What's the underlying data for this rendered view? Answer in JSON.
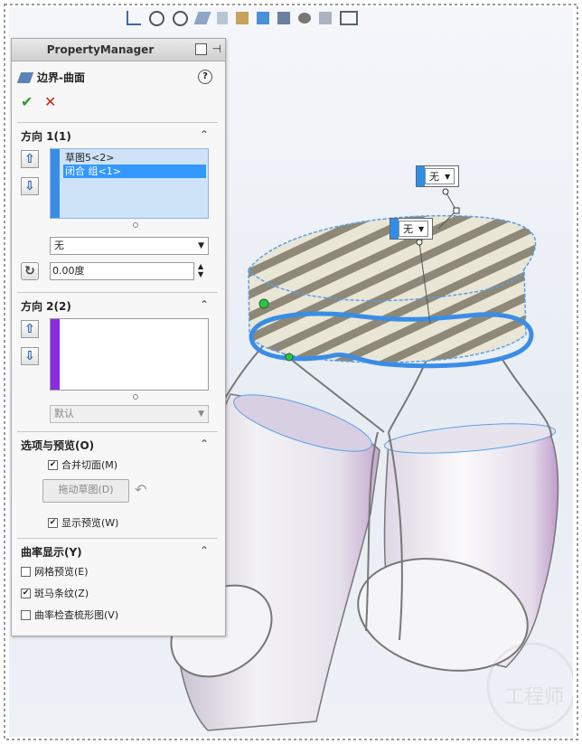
{
  "toolbar": {
    "icons": [
      "view-orientation-icon",
      "zoom-fit-icon",
      "zoom-area-icon",
      "previous-view-icon",
      "section-view-icon",
      "view-settings-icon",
      "display-style-icon",
      "hide-show-icon",
      "edit-appearance-icon",
      "apply-scene-icon",
      "display-manager-icon"
    ]
  },
  "property_manager": {
    "title": "PropertyManager",
    "feature_title": "边界-曲面",
    "direction1": {
      "header": "方向 1(1)",
      "items": [
        "草图5<2>",
        "闭合 组<1>"
      ],
      "selected_index": 1,
      "tangent_option": "无",
      "angle_value": "0.00度",
      "stripe_color": "#3a8de6"
    },
    "direction2": {
      "header": "方向 2(2)",
      "items": [],
      "tangent_option": "默认",
      "stripe_color": "#8a2be2"
    },
    "options": {
      "header": "选项与预览(O)",
      "merge_tangent_faces": {
        "label": "合并切面(M)",
        "checked": true
      },
      "drag_sketch_button": "拖动草图(D)",
      "show_preview": {
        "label": "显示预览(W)",
        "checked": true
      }
    },
    "curvature": {
      "header": "曲率显示(Y)",
      "mesh_preview": {
        "label": "网格预览(E)",
        "checked": false
      },
      "zebra_stripes": {
        "label": "斑马条纹(Z)",
        "checked": true
      },
      "curvature_comb": {
        "label": "曲率检查梳形图(V)",
        "checked": false
      }
    }
  },
  "callouts": {
    "top": {
      "label": "无"
    },
    "bottom": {
      "label": "无"
    }
  },
  "colors": {
    "accent": "#3a8de6",
    "selection": "#3399ff",
    "ok": "#2e9a2e",
    "cancel": "#c9271c"
  }
}
